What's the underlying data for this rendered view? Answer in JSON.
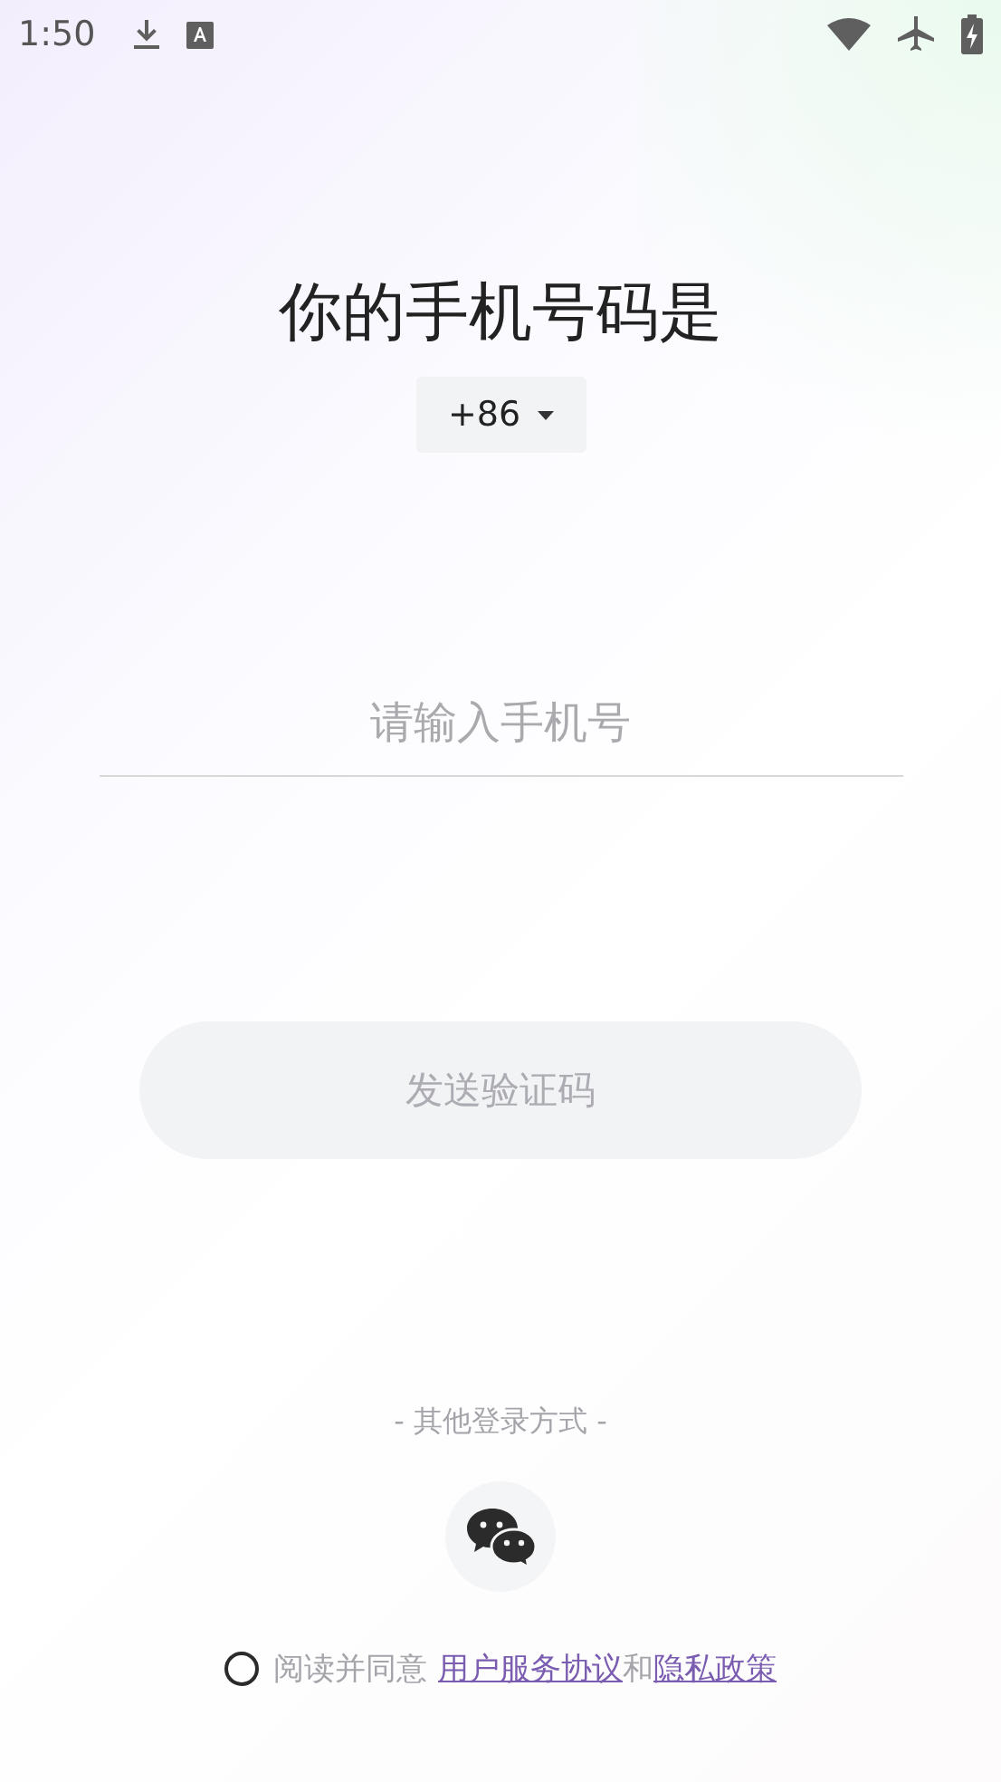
{
  "status_bar": {
    "time": "1:50"
  },
  "title": "你的手机号码是",
  "country_code": {
    "value": "+86"
  },
  "phone_field": {
    "placeholder": "请输入手机号"
  },
  "send_button": {
    "label": "发送验证码",
    "disabled": true
  },
  "other_login": {
    "label": "- 其他登录方式 -"
  },
  "agreement": {
    "checked": false,
    "parts": [
      {
        "kind": "text",
        "text": "阅读并同意"
      },
      {
        "kind": "link",
        "text": "用户服务协议"
      },
      {
        "kind": "text",
        "text": "和"
      },
      {
        "kind": "link",
        "text": "隐私政策"
      }
    ]
  }
}
